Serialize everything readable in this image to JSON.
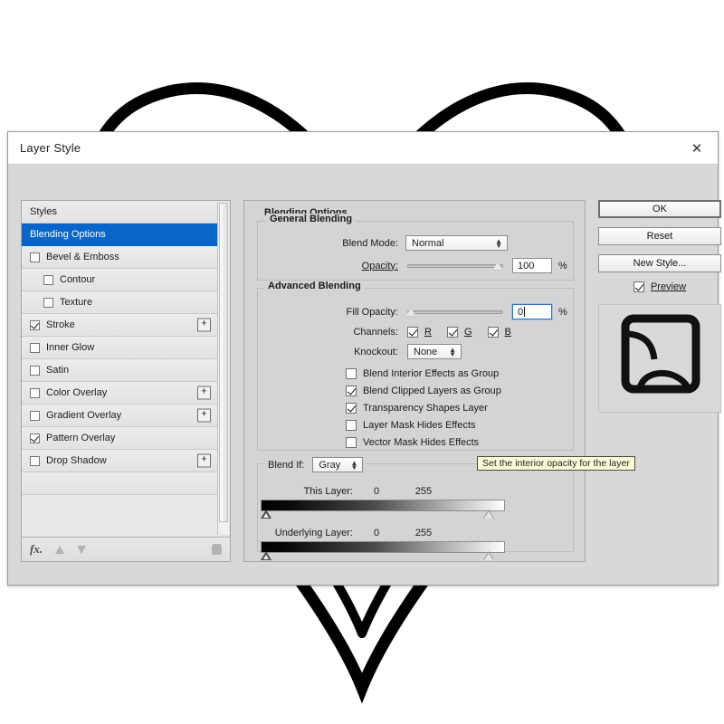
{
  "window": {
    "title": "Layer Style",
    "close_icon": "close-icon"
  },
  "styles_list": {
    "items": [
      {
        "label": "Styles",
        "checkbox": null,
        "plus": false,
        "selected": false,
        "indent": false
      },
      {
        "label": "Blending Options",
        "checkbox": null,
        "plus": false,
        "selected": true,
        "indent": false
      },
      {
        "label": "Bevel & Emboss",
        "checkbox": false,
        "plus": false,
        "selected": false,
        "indent": false
      },
      {
        "label": "Contour",
        "checkbox": false,
        "plus": false,
        "selected": false,
        "indent": true
      },
      {
        "label": "Texture",
        "checkbox": false,
        "plus": false,
        "selected": false,
        "indent": true
      },
      {
        "label": "Stroke",
        "checkbox": true,
        "plus": true,
        "selected": false,
        "indent": false
      },
      {
        "label": "Inner Glow",
        "checkbox": false,
        "plus": false,
        "selected": false,
        "indent": false
      },
      {
        "label": "Satin",
        "checkbox": false,
        "plus": false,
        "selected": false,
        "indent": false
      },
      {
        "label": "Color Overlay",
        "checkbox": false,
        "plus": true,
        "selected": false,
        "indent": false
      },
      {
        "label": "Gradient Overlay",
        "checkbox": false,
        "plus": true,
        "selected": false,
        "indent": false
      },
      {
        "label": "Pattern Overlay",
        "checkbox": true,
        "plus": false,
        "selected": false,
        "indent": false
      },
      {
        "label": "Drop Shadow",
        "checkbox": false,
        "plus": true,
        "selected": false,
        "indent": false
      }
    ],
    "footer": {
      "fx_icon": "fx-icon",
      "move_up_icon": "arrow-up-icon",
      "move_down_icon": "arrow-down-icon",
      "delete_icon": "trash-icon"
    }
  },
  "blending": {
    "section_title": "Blending Options",
    "general": {
      "title": "General Blending",
      "blend_mode_label": "Blend Mode:",
      "blend_mode_value": "Normal",
      "opacity_label": "Opacity:",
      "opacity_value": "100",
      "opacity_unit": "%",
      "opacity_percent": 100
    },
    "advanced": {
      "title": "Advanced Blending",
      "fill_opacity_label": "Fill Opacity:",
      "fill_opacity_value": "0",
      "fill_opacity_unit": "%",
      "fill_opacity_percent": 0,
      "channels_label": "Channels:",
      "channels": [
        {
          "label": "R",
          "checked": true
        },
        {
          "label": "G",
          "checked": true
        },
        {
          "label": "B",
          "checked": true
        }
      ],
      "knockout_label": "Knockout:",
      "knockout_value": "None",
      "options": [
        {
          "label": "Blend Interior Effects as Group",
          "checked": false
        },
        {
          "label": "Blend Clipped Layers as Group",
          "checked": true
        },
        {
          "label": "Transparency Shapes Layer",
          "checked": true
        },
        {
          "label": "Layer Mask Hides Effects",
          "checked": false
        },
        {
          "label": "Vector Mask Hides Effects",
          "checked": false
        }
      ]
    },
    "blend_if": {
      "label": "Blend If:",
      "channel_value": "Gray",
      "this_layer": {
        "label": "This Layer:",
        "min": "0",
        "max": "255"
      },
      "underlying_layer": {
        "label": "Underlying Layer:",
        "min": "0",
        "max": "255"
      }
    }
  },
  "buttons": {
    "ok": "OK",
    "reset": "Reset",
    "new_style": "New Style...",
    "preview_label": "Preview",
    "preview_checked": true
  },
  "tooltip": {
    "text": "Set the interior opacity for the layer"
  },
  "colors": {
    "selection_blue": "#0a65c8",
    "dialog_bg": "#d4d4d4",
    "tooltip_bg": "#fbfbd4",
    "artwork_stroke": "#000000"
  }
}
